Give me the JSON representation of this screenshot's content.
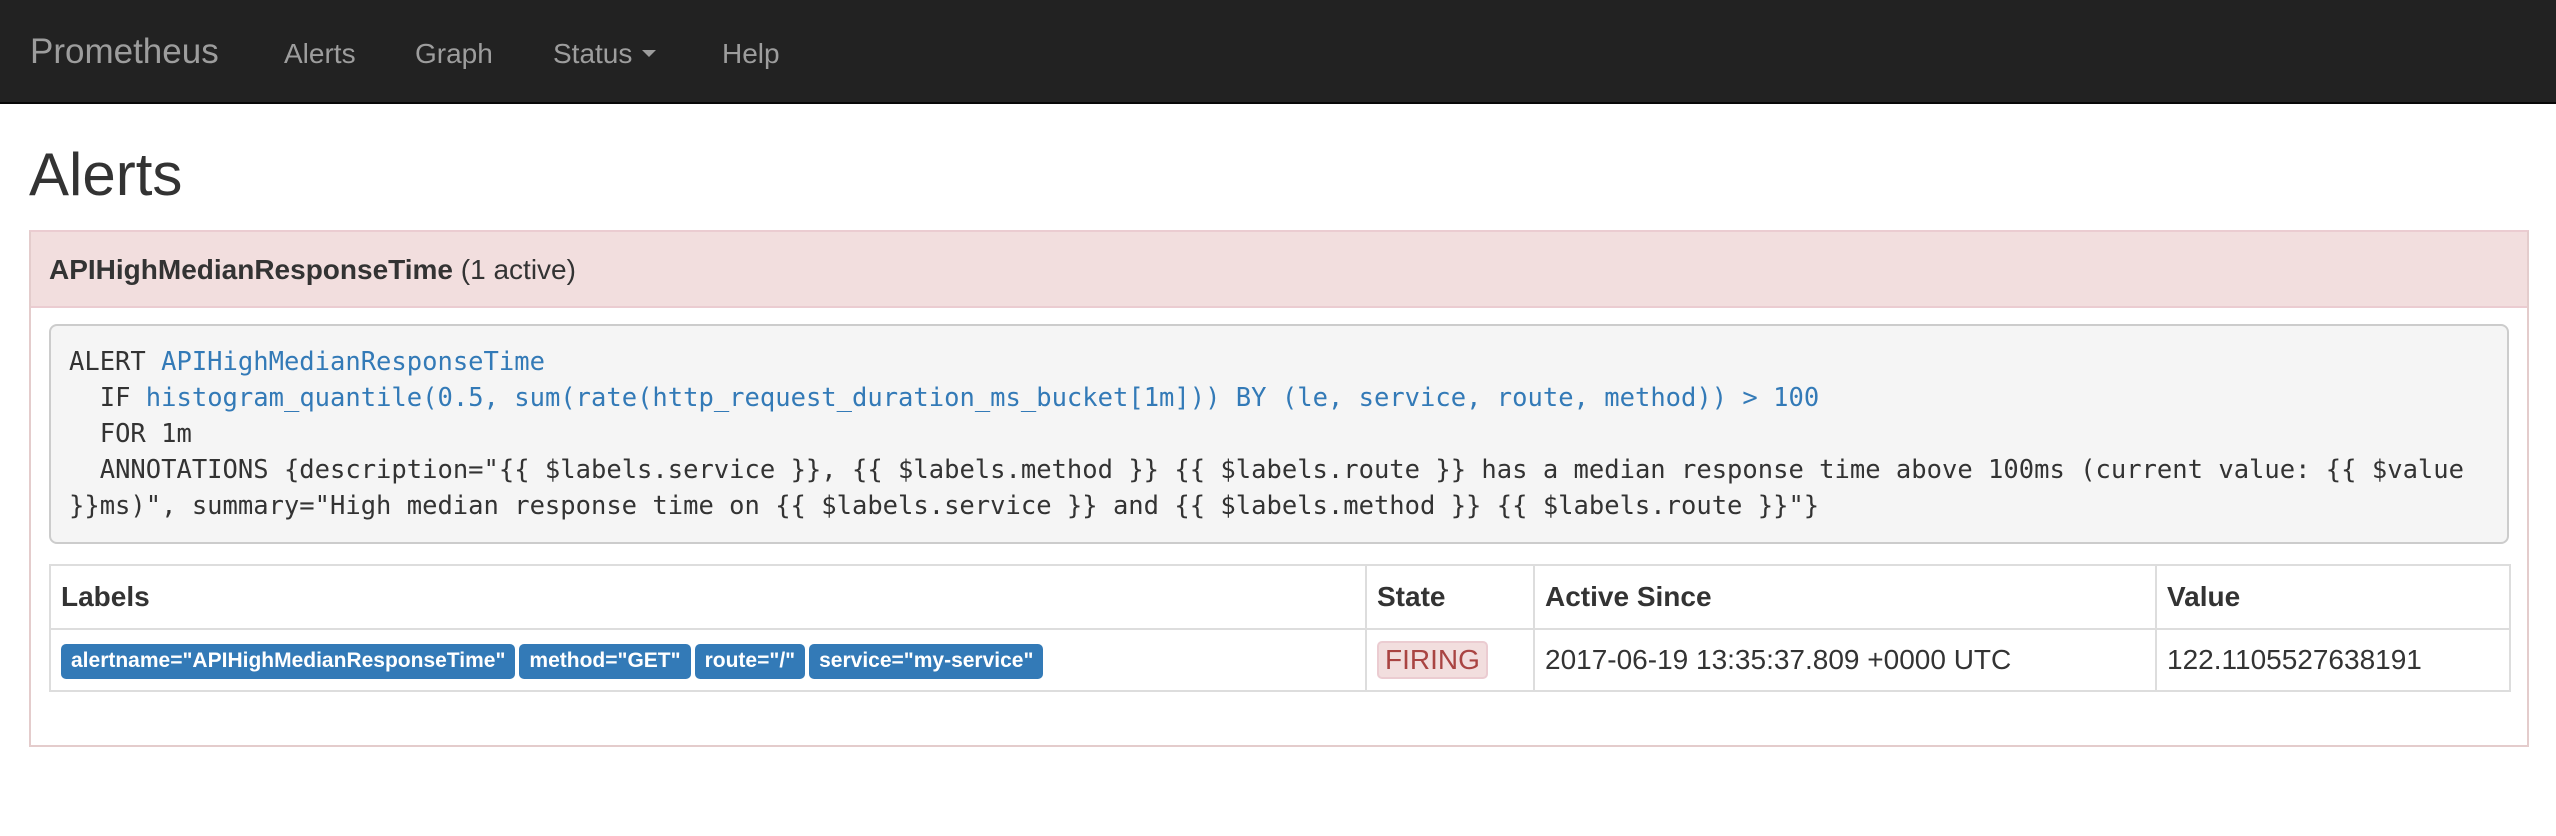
{
  "navbar": {
    "brand": "Prometheus",
    "items": [
      {
        "label": "Alerts"
      },
      {
        "label": "Graph"
      },
      {
        "label": "Status"
      },
      {
        "label": "Help"
      }
    ]
  },
  "page": {
    "title": "Alerts"
  },
  "alert": {
    "name": "APIHighMedianResponseTime",
    "active_count": "(1 active)",
    "rule": {
      "alert_keyword": "ALERT",
      "alert_name": "APIHighMedianResponseTime",
      "if_keyword": "IF",
      "expr": "histogram_quantile(0.5, sum(rate(http_request_duration_ms_bucket[1m])) BY (le, service, route, method)) > 100",
      "for_line": "FOR 1m",
      "annotations": "ANNOTATIONS {description=\"{{ $labels.service }}, {{ $labels.method }} {{ $labels.route }} has a median response time above 100ms (current value: {{ $value }}ms)\", summary=\"High median response time on {{ $labels.service }} and {{ $labels.method }} {{ $labels.route }}\"}"
    },
    "table": {
      "headers": {
        "labels": "Labels",
        "state": "State",
        "active_since": "Active Since",
        "value": "Value"
      },
      "rows": [
        {
          "labels": [
            "alertname=\"APIHighMedianResponseTime\"",
            "method=\"GET\"",
            "route=\"/\"",
            "service=\"my-service\""
          ],
          "state": "FIRING",
          "active_since": "2017-06-19 13:35:37.809 +0000 UTC",
          "value": "122.1105527638191"
        }
      ]
    }
  },
  "colors": {
    "navbar_bg": "#222222",
    "navbar_text": "#9d9d9d",
    "panel_heading_bg": "#f2dede",
    "link": "#337ab7",
    "label_badge_bg": "#337ab7",
    "firing_text": "#a94442"
  }
}
